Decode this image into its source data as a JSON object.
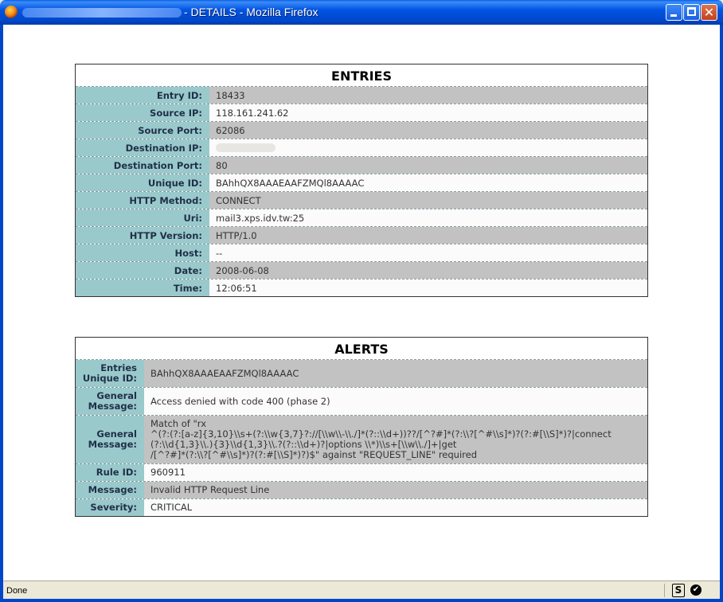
{
  "window": {
    "title": "- DETAILS - Mozilla Firefox"
  },
  "entries": {
    "title": "ENTRIES",
    "rows": [
      {
        "label": "Entry ID:",
        "value": "18433"
      },
      {
        "label": "Source IP:",
        "value": "118.161.241.62"
      },
      {
        "label": "Source Port:",
        "value": "62086"
      },
      {
        "label": "Destination IP:",
        "value": ""
      },
      {
        "label": "Destination Port:",
        "value": "80"
      },
      {
        "label": "Unique ID:",
        "value": "BAhhQX8AAAEAAFZMQl8AAAAC"
      },
      {
        "label": "HTTP Method:",
        "value": "CONNECT"
      },
      {
        "label": "Uri:",
        "value": "mail3.xps.idv.tw:25"
      },
      {
        "label": "HTTP Version:",
        "value": "HTTP/1.0"
      },
      {
        "label": "Host:",
        "value": "--"
      },
      {
        "label": "Date:",
        "value": "2008-06-08"
      },
      {
        "label": "Time:",
        "value": "12:06:51"
      }
    ]
  },
  "alerts": {
    "title": "ALERTS",
    "rows": [
      {
        "label_line1": "Entries",
        "label_line2": "Unique ID:",
        "value": "BAhhQX8AAAEAAFZMQl8AAAAC"
      },
      {
        "label_line1": "General",
        "label_line2": "Message:",
        "value": "Access denied with code 400 (phase 2)"
      },
      {
        "label_line1": "General",
        "label_line2": "Message:",
        "value_line1": "Match of \"rx",
        "value_line2": "^(?:(?:[a-z]{3,10}\\\\s+(?:\\\\w{3,7}?://[\\\\w\\\\-\\\\./]*(?::\\\\d+))??/[^?#]*(?:\\\\?[^#\\\\s]*)?(?:#[\\\\S]*)?|connect",
        "value_line3": "(?:\\\\d{1,3}\\\\.){3}\\\\d{1,3}\\\\.?(?::\\\\d+)?|options \\\\*)\\\\s+[\\\\w\\\\./]+|get",
        "value_line4": "/[^?#]*(?:\\\\?[^#\\\\s]*)?(?:#[\\\\S]*)?)$\" against \"REQUEST_LINE\" required"
      },
      {
        "label": "Rule ID:",
        "value": "960911"
      },
      {
        "label": "Message:",
        "value": "Invalid HTTP Request Line"
      },
      {
        "label": "Severity:",
        "value": "CRITICAL"
      }
    ]
  },
  "statusbar": {
    "text": "Done"
  }
}
